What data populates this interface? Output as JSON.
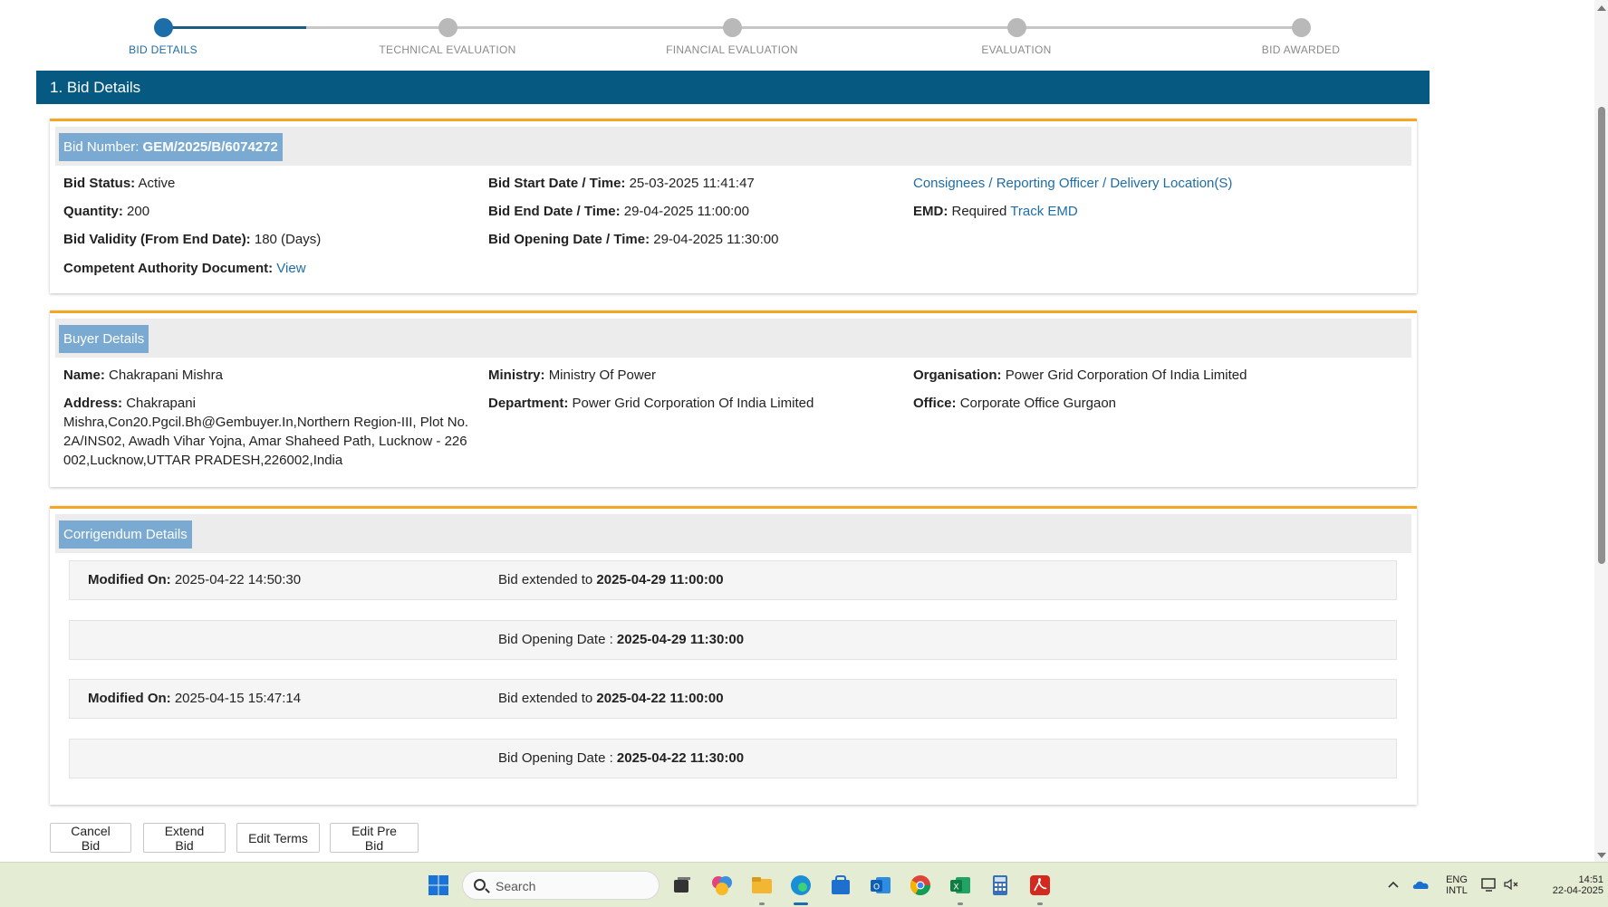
{
  "stepper": {
    "steps": [
      {
        "label": "BID DETAILS"
      },
      {
        "label": "TECHNICAL EVALUATION"
      },
      {
        "label": "FINANCIAL EVALUATION"
      },
      {
        "label": "EVALUATION"
      },
      {
        "label": "BID AWARDED"
      }
    ],
    "active_index": 0,
    "progress_fraction": 0.2
  },
  "section_title": "1. Bid Details",
  "bid_panel": {
    "tag_label": "Bid Number: ",
    "bid_number": "GEM/2025/B/6074272",
    "status_label": "Bid Status:",
    "status_value": "Active",
    "quantity_label": "Quantity:",
    "quantity_value": "200",
    "validity_label": "Bid Validity (From End Date):",
    "validity_value": "180 (Days)",
    "authority_label": "Competent Authority Document:",
    "authority_link": "View",
    "start_label": "Bid Start Date / Time:",
    "start_value": "25-03-2025 11:41:47",
    "end_label": "Bid End Date / Time:",
    "end_value": "29-04-2025 11:00:00",
    "opening_label": "Bid Opening Date / Time:",
    "opening_value": "29-04-2025 11:30:00",
    "consignees_link": "Consignees / Reporting Officer / Delivery Location(S)",
    "emd_label": "EMD:",
    "emd_value": "Required",
    "emd_link": "Track EMD"
  },
  "buyer_panel": {
    "tag_label": "Buyer Details",
    "name_label": "Name:",
    "name_value": "Chakrapani Mishra",
    "address_label": "Address:",
    "address_line1": "Chakrapani",
    "address_line2": "Mishra,Con20.Pgcil.Bh@Gembuyer.In,Northern Region-III, Plot No.",
    "address_line3": "2A/INS02, Awadh Vihar Yojna, Amar Shaheed Path, Lucknow - 226",
    "address_line4": "002,Lucknow,UTTAR PRADESH,226002,India",
    "ministry_label": "Ministry:",
    "ministry_value": "Ministry Of Power",
    "department_label": "Department:",
    "department_value": "Power Grid Corporation Of India Limited",
    "organisation_label": "Organisation:",
    "organisation_value": "Power Grid Corporation Of India Limited",
    "office_label": "Office:",
    "office_value": "Corporate Office Gurgaon"
  },
  "corrigendum_panel": {
    "tag_label": "Corrigendum Details",
    "rows": [
      {
        "modified_label": "Modified On:",
        "modified_value": "2025-04-22 14:50:30",
        "text": "Bid extended to ",
        "value": "2025-04-29 11:00:00"
      },
      {
        "modified_label": "",
        "modified_value": "",
        "text": "Bid Opening Date : ",
        "value": "2025-04-29 11:30:00"
      },
      {
        "modified_label": "Modified On:",
        "modified_value": "2025-04-15 15:47:14",
        "text": "Bid extended to ",
        "value": "2025-04-22 11:00:00"
      },
      {
        "modified_label": "",
        "modified_value": "",
        "text": "Bid Opening Date : ",
        "value": "2025-04-22 11:30:00"
      }
    ]
  },
  "actions": {
    "cancel": "Cancel Bid",
    "extend": "Extend Bid",
    "edit_terms": "Edit Terms",
    "edit_pre_bid": "Edit Pre Bid"
  },
  "taskbar": {
    "search_placeholder": "Search",
    "lang_top": "ENG",
    "lang_bottom": "INTL",
    "time": "14:51",
    "date": "22-04-2025"
  },
  "colors": {
    "header_band": "#065a82",
    "panel_accent": "#f5a623",
    "tag_bg": "#7aaad2",
    "link": "#1d6da8"
  }
}
